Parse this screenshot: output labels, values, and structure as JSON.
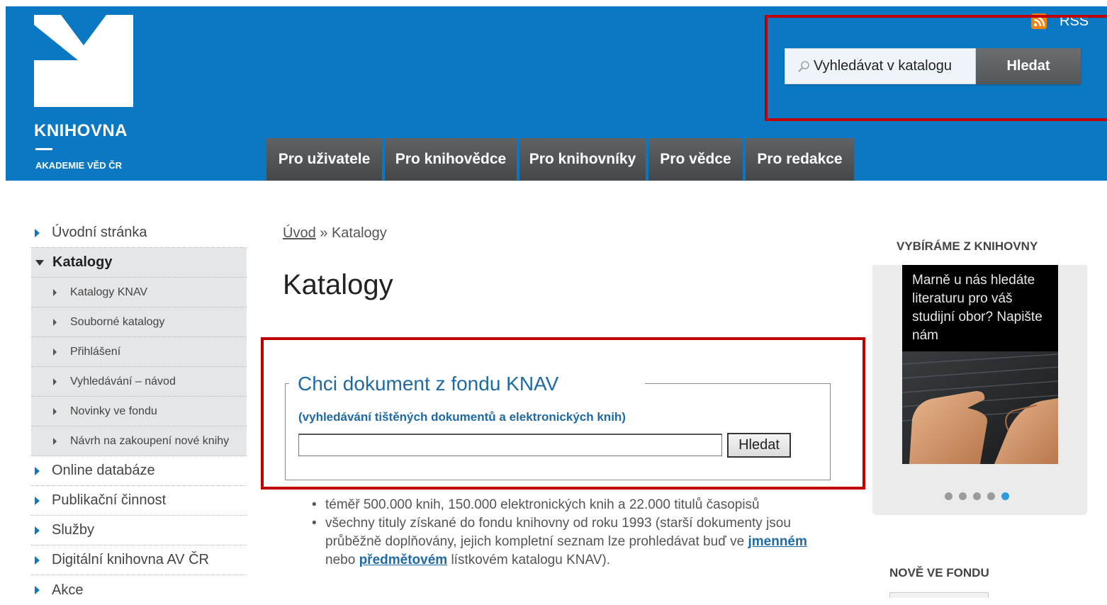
{
  "header": {
    "logo_name": "KNIHOVNA",
    "logo_subtitle": "AKADEMIE VĚD ČR",
    "rss_label": "RSS",
    "search_placeholder": "Vyhledávat v katalogu",
    "search_button": "Hledat",
    "nav": [
      "Pro uživatele",
      "Pro knihovědce",
      "Pro knihovníky",
      "Pro vědce",
      "Pro redakce"
    ]
  },
  "sidebar": {
    "items": [
      {
        "label": "Úvodní stránka",
        "level": 1,
        "state": "closed"
      },
      {
        "label": "Katalogy",
        "level": 1,
        "state": "open"
      },
      {
        "label": "Katalogy KNAV",
        "level": 2
      },
      {
        "label": "Souborné katalogy",
        "level": 2
      },
      {
        "label": "Přihlášení",
        "level": 2
      },
      {
        "label": "Vyhledávání – návod",
        "level": 2
      },
      {
        "label": "Novinky ve fondu",
        "level": 2
      },
      {
        "label": "Návrh na zakoupení nové knihy",
        "level": 2
      },
      {
        "label": "Online databáze",
        "level": 1,
        "state": "closed"
      },
      {
        "label": "Publikační činnost",
        "level": 1,
        "state": "closed"
      },
      {
        "label": "Služby",
        "level": 1,
        "state": "closed"
      },
      {
        "label": "Digitální knihovna AV ČR",
        "level": 1,
        "state": "closed"
      },
      {
        "label": "Akce",
        "level": 1,
        "state": "closed"
      }
    ]
  },
  "main": {
    "breadcrumb": {
      "home": "Úvod",
      "separator": "»",
      "current": "Katalogy"
    },
    "title": "Katalogy",
    "search_box": {
      "legend": "Chci dokument z fondu KNAV",
      "subtitle": "(vyhledávání tištěných dokumentů a elektronických knih)",
      "input_value": "",
      "button": "Hledat"
    },
    "info": {
      "line1": "téměř 500.000 knih, 150.000 elektronických knih a 22.000 titulů časopisů",
      "line2_start": "všechny tituly získané do fondu knihovny od roku 1993 (starší dokumenty jsou průběžně doplňovány, jejich kompletní seznam lze prohledávat buď ve",
      "link1": "jmenném",
      "line2_mid": "nebo",
      "link2": "předmětovém",
      "line2_end": "lístkovém katalogu KNAV)."
    }
  },
  "right": {
    "heading1": "VYBÍRÁME Z KNIHOVNY",
    "promo_text": "Marně u nás hledáte literaturu pro váš studijní obor? Napište nám",
    "carousel": {
      "count": 5,
      "active": 5
    },
    "heading2": "NOVĚ VE FONDU"
  },
  "colors": {
    "brand_blue": "#0a78c2",
    "nav_gray": "#54575a",
    "highlight_red": "#c00000",
    "link_blue": "#1d6aa5",
    "rss_orange": "#f0820e"
  }
}
